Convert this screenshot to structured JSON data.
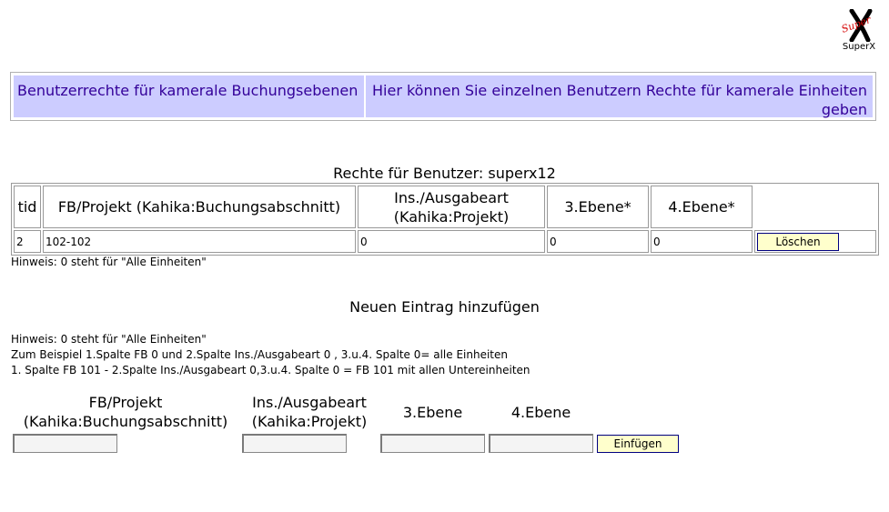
{
  "logo": {
    "brand": "SuperX",
    "mark_text": "Super",
    "caption": "SuperX"
  },
  "header": {
    "title": "Benutzerrechte für kamerale Buchungsebenen",
    "description": "Hier können Sie einzelnen Benutzern Rechte für kamerale Einheiten geben"
  },
  "rights": {
    "title": "Rechte für Benutzer: superx12",
    "columns": [
      "tid",
      "FB/Projekt (Kahika:Buchungsabschnitt)",
      "Ins./Ausgabeart (Kahika:Projekt)",
      "3.Ebene*",
      "4.Ebene*"
    ],
    "rows": [
      {
        "tid": "2",
        "fb": "102-102",
        "ins": "0",
        "e3": "0",
        "e4": "0",
        "delete_label": "Löschen"
      }
    ],
    "hint": "Hinweis: 0 steht für \"Alle Einheiten\""
  },
  "add": {
    "title": "Neuen Eintrag hinzufügen",
    "hint_lines": [
      "Hinweis: 0 steht für \"Alle Einheiten\"",
      "Zum Beispiel 1.Spalte FB 0 und 2.Spalte Ins./Ausgabeart 0 , 3.u.4. Spalte 0= alle Einheiten",
      "1. Spalte FB 101 - 2.Spalte Ins./Ausgabeart 0,3.u.4. Spalte 0 = FB 101 mit allen Untereinheiten"
    ],
    "fields": {
      "fb_label": "FB/Projekt (Kahika:Buchungsabschnitt)",
      "ins_label": "Ins./Ausgabeart (Kahika:Projekt)",
      "e3_label": "3.Ebene",
      "e4_label": "4.Ebene",
      "fb_value": "",
      "ins_value": "",
      "e3_value": "",
      "e4_value": ""
    },
    "submit_label": "Einfügen"
  }
}
